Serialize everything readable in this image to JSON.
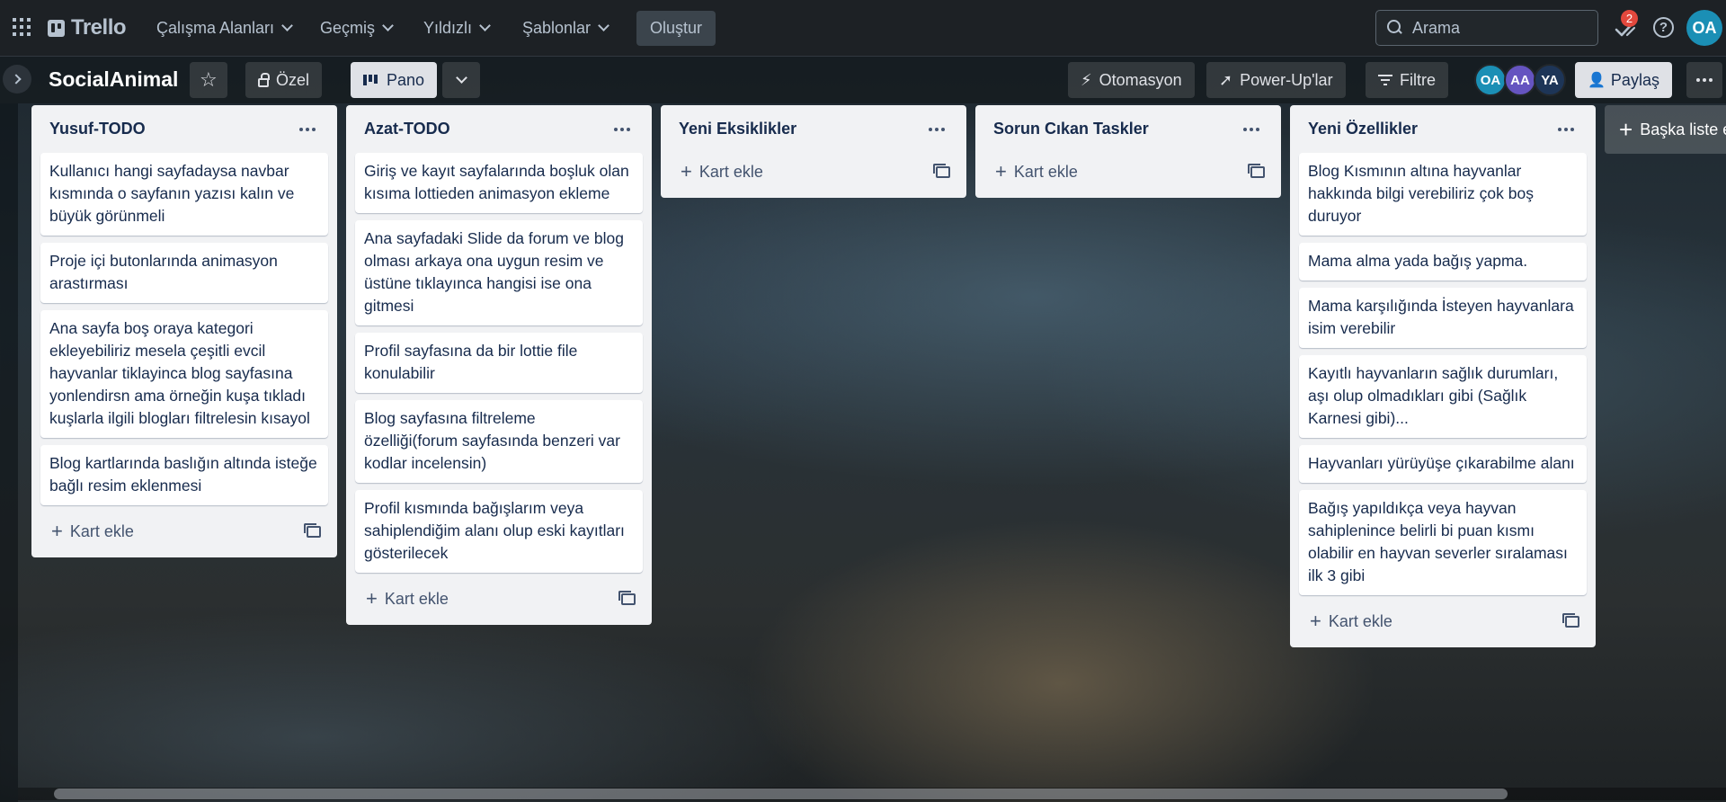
{
  "topnav": {
    "logo": "Trello",
    "menus": [
      {
        "label": "Çalışma Alanları"
      },
      {
        "label": "Geçmiş"
      },
      {
        "label": "Yıldızlı"
      },
      {
        "label": "Şablonlar"
      }
    ],
    "create_label": "Oluştur",
    "search_placeholder": "Arama",
    "notification_count": "2",
    "help_label": "?",
    "user_initials": "OA"
  },
  "board": {
    "title": "SocialAnimal",
    "visibility_label": "Özel",
    "view_label": "Pano",
    "automation_label": "Otomasyon",
    "powerups_label": "Power-Up'lar",
    "filter_label": "Filtre",
    "members": [
      {
        "initials": "OA",
        "color": "#1b8fb5"
      },
      {
        "initials": "AA",
        "color": "#6554c0"
      },
      {
        "initials": "YA",
        "color": "#1d3557"
      }
    ],
    "share_label": "Paylaş"
  },
  "lists": [
    {
      "title": "Yusuf-TODO",
      "cards": [
        "Kullanıcı hangi sayfadaysa navbar kısmında o sayfanın yazısı kalın ve büyük görünmeli",
        "Proje içi butonlarında animasyon arastırması",
        "Ana sayfa boş oraya kategori ekleyebiliriz mesela çeşitli evcil hayvanlar tiklayinca blog sayfasına yonlendirsn ama örneğin kuşa tıkladı kuşlarla ilgili blogları filtrelesin kısayol",
        "Blog kartlarında baslığın altında isteğe bağlı resim eklenmesi"
      ],
      "add_label": "Kart ekle"
    },
    {
      "title": "Azat-TODO",
      "cards": [
        "Giriş ve kayıt sayfalarında boşluk olan kısıma lottieden animasyon ekleme",
        "Ana sayfadaki Slide da forum ve blog olması arkaya ona uygun resim ve üstüne tıklayınca hangisi ise ona gitmesi",
        "Profil sayfasına da bir lottie file konulabilir",
        "Blog sayfasına filtreleme özelliği(forum sayfasında benzeri var kodlar incelensin)",
        "Profil kısmında bağışlarım veya sahiplendiğim alanı olup eski kayıtları gösterilecek"
      ],
      "add_label": "Kart ekle"
    },
    {
      "title": "Yeni Eksiklikler",
      "cards": [],
      "add_label": "Kart ekle"
    },
    {
      "title": "Sorun Cıkan Taskler",
      "cards": [],
      "add_label": "Kart ekle"
    },
    {
      "title": "Yeni Özellikler",
      "cards": [
        "Blog Kısmının altına hayvanlar hakkında bilgi verebiliriz çok boş duruyor",
        "Mama alma yada bağış yapma.",
        "Mama karşılığında İsteyen hayvanlara isim verebilir",
        "Kayıtlı hayvanların sağlık durumları, aşı olup olmadıkları gibi (Sağlık Karnesi gibi)...",
        "Hayvanları yürüyüşe çıkarabilme alanı",
        "Bağış yapıldıkça veya hayvan sahiplenince belirli bi puan kısmı olabilir en hayvan severler sıralaması ilk 3 gibi"
      ],
      "add_label": "Kart ekle"
    }
  ],
  "add_another_list_label": "Başka liste ekle"
}
